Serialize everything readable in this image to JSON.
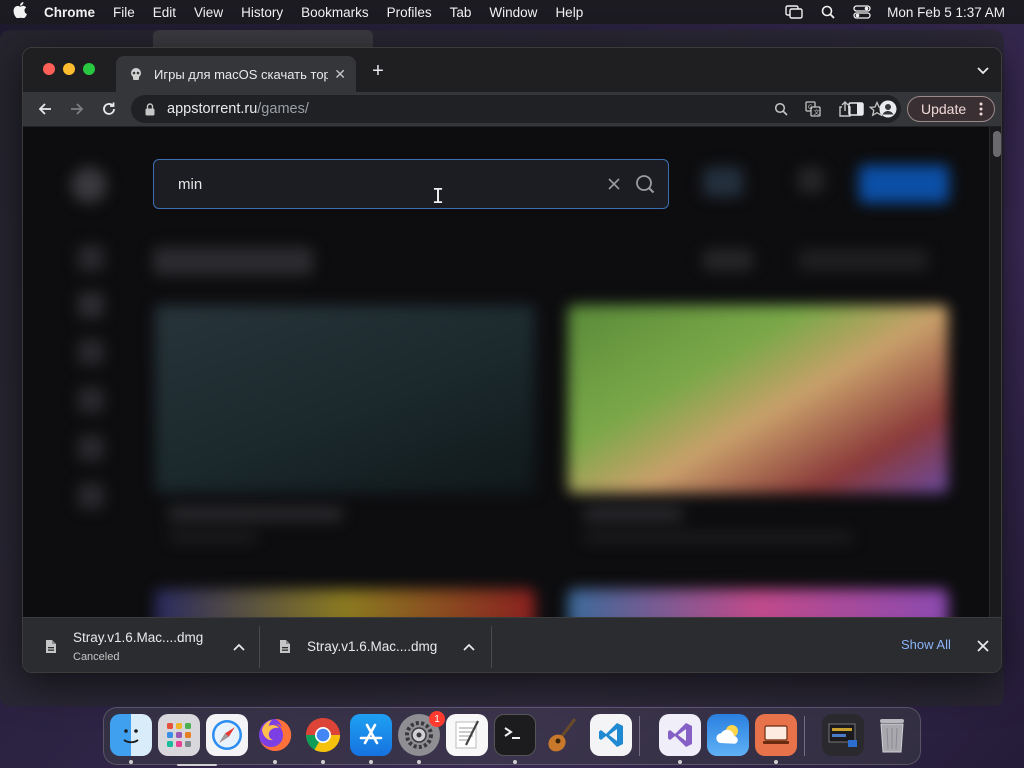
{
  "menubar": {
    "app_name": "Chrome",
    "items": [
      "File",
      "Edit",
      "View",
      "History",
      "Bookmarks",
      "Profiles",
      "Tab",
      "Window",
      "Help"
    ],
    "clock": "Mon Feb 5  1:37 AM"
  },
  "browser": {
    "tab": {
      "title": "Игры для macOS скачать торрент"
    },
    "address": {
      "domain": "appstorrent.ru",
      "path": "/games/"
    },
    "update_label": "Update"
  },
  "page": {
    "search": {
      "value": "min"
    }
  },
  "downloads": {
    "items": [
      {
        "filename": "Stray.v1.6.Mac....dmg",
        "status": "Canceled"
      },
      {
        "filename": "Stray.v1.6.Mac....dmg",
        "status": ""
      }
    ],
    "show_all_label": "Show All"
  },
  "dock": {
    "apps": [
      "finder-icon",
      "launchpad-icon",
      "safari-icon",
      "firefox-icon",
      "chrome-icon",
      "app-store-icon",
      "system-settings-icon",
      "textedit-icon",
      "terminal-icon",
      "guitar-icon",
      "vscode-icon",
      "visual-studio-icon",
      "weather-icon",
      "remote-desktop-icon",
      "screenshot-stack-icon",
      "trash-icon"
    ],
    "settings_badge": "1"
  },
  "colors": {
    "accent": "#8ab4f8",
    "search_border": "#3d6fb0",
    "update_border": "#9b8a8a"
  }
}
